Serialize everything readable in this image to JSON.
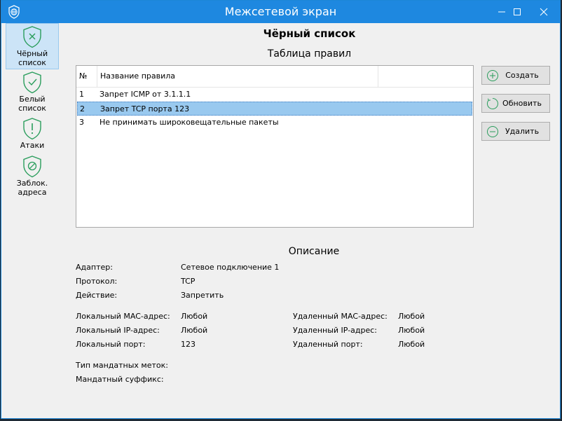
{
  "window": {
    "title": "Межсетевой экран"
  },
  "colors": {
    "titlebar": "#1e88e0",
    "icon_green": "#2a9d5c",
    "selection": "#99c9ef"
  },
  "sidebar": {
    "items": [
      {
        "line1": "Чёрный",
        "line2": "список",
        "icon": "shield-x-icon",
        "active": true
      },
      {
        "line1": "Белый",
        "line2": "список",
        "icon": "shield-check-icon",
        "active": false
      },
      {
        "line1": "Атаки",
        "line2": "",
        "icon": "shield-exclamation-icon",
        "active": false
      },
      {
        "line1": "Заблок.",
        "line2": "адреса",
        "icon": "shield-blocked-icon",
        "active": false
      }
    ]
  },
  "main": {
    "title": "Чёрный список",
    "table_title": "Таблица правил",
    "columns": [
      "№",
      "Название правила",
      ""
    ],
    "rows": [
      {
        "num": "1",
        "name": "Запрет ICMP от 3.1.1.1",
        "selected": false
      },
      {
        "num": "2",
        "name": "Запрет TCP порта 123",
        "selected": true
      },
      {
        "num": "3",
        "name": "Не принимать широковещательные пакеты",
        "selected": false
      }
    ]
  },
  "actions": {
    "create": "Создать",
    "refresh": "Обновить",
    "delete": "Удалить"
  },
  "description": {
    "title": "Описание",
    "adapter_label": "Адаптер:",
    "adapter_value": "Сетевое подключение 1",
    "protocol_label": "Протокол:",
    "protocol_value": "TCP",
    "action_label": "Действие:",
    "action_value": "Запретить",
    "local_mac_label": "Локальный MAC-адрес:",
    "local_mac_value": "Любой",
    "local_ip_label": "Локальный IP-адрес:",
    "local_ip_value": "Любой",
    "local_port_label": "Локальный порт:",
    "local_port_value": "123",
    "remote_mac_label": "Удаленный MAC-адрес:",
    "remote_mac_value": "Любой",
    "remote_ip_label": "Удаленный IP-адрес:",
    "remote_ip_value": "Любой",
    "remote_port_label": "Удаленный порт:",
    "remote_port_value": "Любой",
    "mandatory_tag_label": "Тип мандатных меток:",
    "mandatory_suffix_label": "Мандатный суффикс:"
  }
}
